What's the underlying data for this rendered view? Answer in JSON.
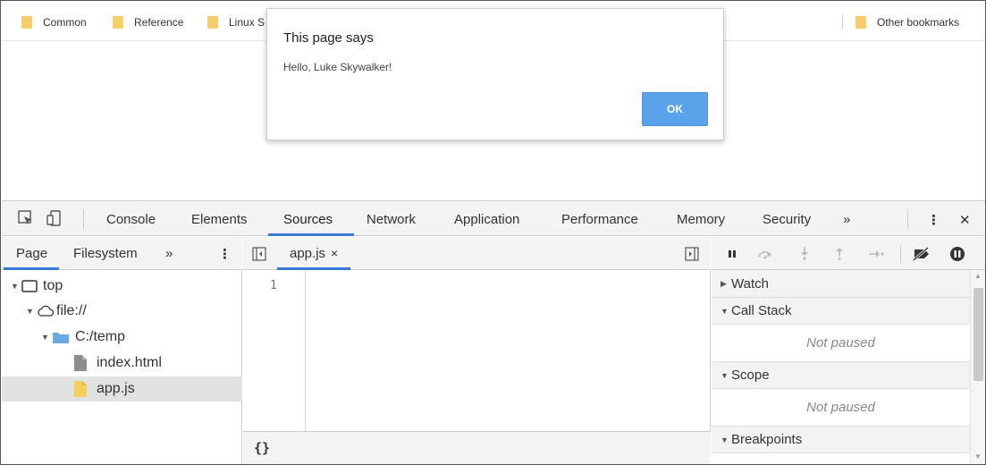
{
  "bookmarks": {
    "items": [
      "Common",
      "Reference",
      "Linux S"
    ],
    "other": "Other bookmarks"
  },
  "dialog": {
    "title": "This page says",
    "message": "Hello, Luke Skywalker!",
    "ok_label": "OK"
  },
  "devtools": {
    "tabs": [
      "Console",
      "Elements",
      "Sources",
      "Network",
      "Application",
      "Performance",
      "Memory",
      "Security"
    ],
    "more_tabs": "»",
    "menu": "⋮",
    "close": "✕",
    "active_tab": "Sources",
    "accent_color": "#3879d9"
  },
  "navigator": {
    "tabs": [
      "Page",
      "Filesystem"
    ],
    "more": "»",
    "menu": "⋮",
    "tree": [
      {
        "label": "top",
        "icon": "frame-icon"
      },
      {
        "label": "file://",
        "icon": "cloud-icon"
      },
      {
        "label": "C:/temp",
        "icon": "folder-icon"
      },
      {
        "label": "index.html",
        "icon": "file-icon"
      },
      {
        "label": "app.js",
        "icon": "js-file-icon",
        "selected": true
      }
    ]
  },
  "editor": {
    "file_tab": "app.js",
    "close": "×",
    "line_numbers": [
      "1"
    ],
    "pretty_print": "{}"
  },
  "debugger": {
    "sections": {
      "watch": "Watch",
      "call_stack": "Call Stack",
      "scope": "Scope",
      "breakpoints": "Breakpoints"
    },
    "call_stack_status": "Not paused",
    "scope_status": "Not paused"
  }
}
